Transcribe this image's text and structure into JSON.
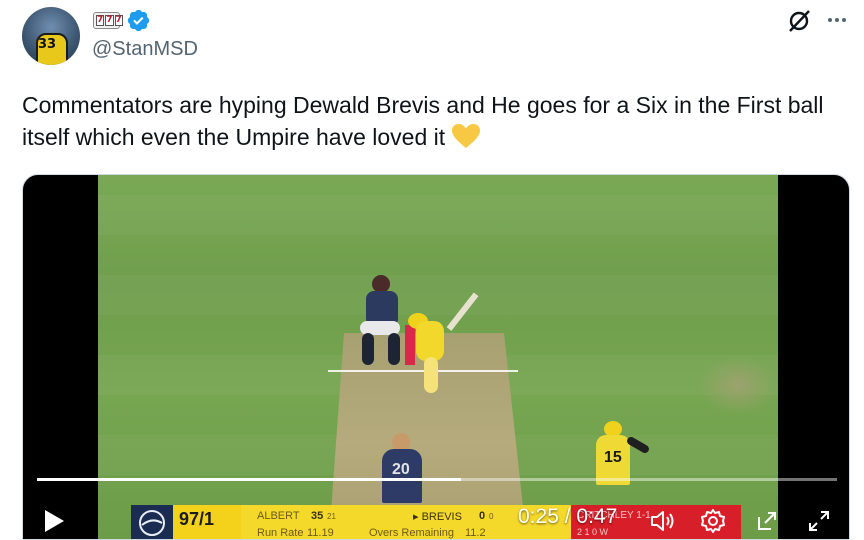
{
  "author": {
    "handle": "@StanMSD",
    "avatar_number": "33",
    "badge_glyphs": [
      "7",
      "7",
      "7"
    ],
    "verified_color": "#1d9bf0"
  },
  "tweet": {
    "text": "Commentators are hyping Dewald Brevis and He goes for a Six in the First ball itself which even the Umpire have loved it",
    "emoji": "yellow-heart"
  },
  "video": {
    "players": {
      "batter_number": "",
      "bowler_number": "20",
      "fielder_number": "15"
    },
    "scoreboard": {
      "score": "97/1",
      "batter1_name": "ALBERT",
      "batter1_runs": "35",
      "batter1_balls": "21",
      "run_rate_label": "Run Rate",
      "run_rate": "11.19",
      "batter2_name": "▸ BREVIS",
      "batter2_runs": "0",
      "batter2_balls": "0",
      "overs_label": "Overs Remaining",
      "overs_remaining": "11.2",
      "bowler_label": "CRITCHLEY 1-1",
      "bowler_figures": "2 1 0 W"
    },
    "current_time": "0:25",
    "duration": "0:47",
    "progress_fraction": 0.53
  },
  "icons": {
    "more": "more-icon",
    "grok": "grok-icon",
    "play": "play-icon",
    "volume": "volume-icon",
    "settings": "settings-icon",
    "popout": "popout-icon",
    "fullscreen": "fullscreen-icon"
  },
  "colors": {
    "accent": "#1d9bf0",
    "scorebar_yellow": "#f5d92a",
    "scorebar_red": "#d81e28",
    "heart": "#f7c843"
  }
}
